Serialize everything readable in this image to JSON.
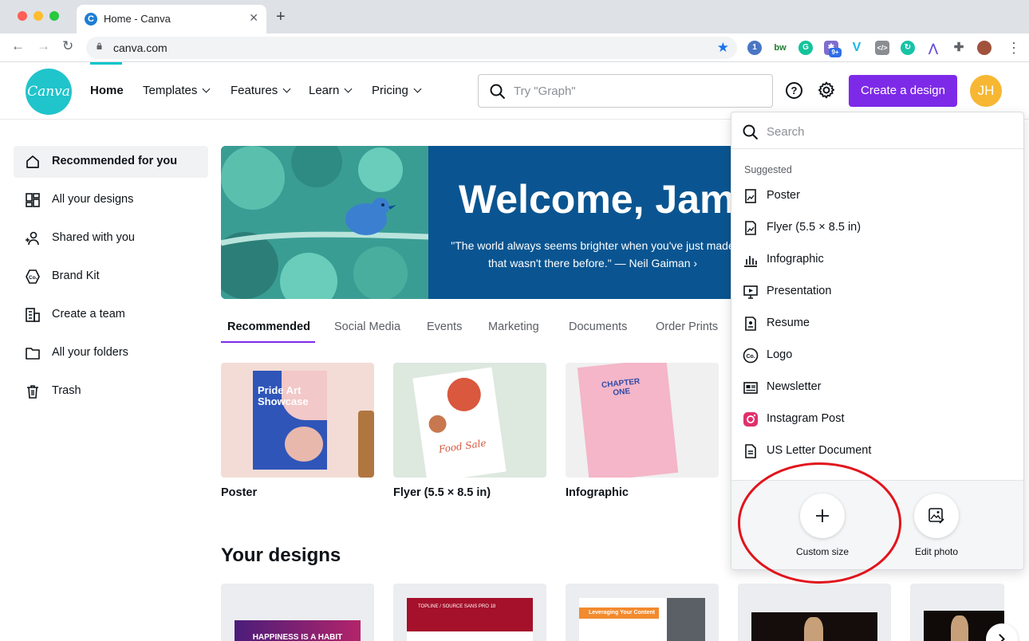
{
  "browser": {
    "tab_title": "Home - Canva",
    "favicon_letter": "C",
    "url": "canva.com",
    "extension_badge": "9+"
  },
  "header": {
    "logo_text": "Canva",
    "nav": [
      {
        "label": "Home"
      },
      {
        "label": "Templates"
      },
      {
        "label": "Features"
      },
      {
        "label": "Learn"
      },
      {
        "label": "Pricing"
      }
    ],
    "search_placeholder": "Try \"Graph\"",
    "help_glyph": "?",
    "create_button": "Create a design",
    "avatar_initials": "JH"
  },
  "sidebar": {
    "items": [
      {
        "label": "Recommended for you",
        "icon": "home-icon"
      },
      {
        "label": "All your designs",
        "icon": "grid-icon"
      },
      {
        "label": "Shared with you",
        "icon": "people-add-icon"
      },
      {
        "label": "Brand Kit",
        "icon": "brand-kit-icon"
      },
      {
        "label": "Create a team",
        "icon": "building-icon"
      },
      {
        "label": "All your folders",
        "icon": "folder-icon"
      },
      {
        "label": "Trash",
        "icon": "trash-icon"
      }
    ]
  },
  "banner": {
    "title": "Welcome, Jame",
    "quote_line1": "\"The world always seems brighter when you've just made",
    "quote_line2": "that wasn't there before.\" — Neil Gaiman ›"
  },
  "categories": {
    "tabs": [
      "Recommended",
      "Social Media",
      "Events",
      "Marketing",
      "Documents",
      "Order Prints"
    ]
  },
  "templates": [
    {
      "label": "Poster",
      "thumb_title": "Pride Art Showcase"
    },
    {
      "label": "Flyer (5.5 × 8.5 in)",
      "thumb_title": "Food Sale"
    },
    {
      "label": "Infographic",
      "thumb_title": "CHAPTER ONE"
    }
  ],
  "your_designs": {
    "title": "Your designs",
    "thumbs": [
      "HAPPINESS IS A HABIT",
      "TOPLINE / SOURCE SANS PRO 18",
      "Leveraging Your Content",
      "",
      ""
    ]
  },
  "dropdown": {
    "search_placeholder": "Search",
    "heading": "Suggested",
    "items": [
      {
        "label": "Poster",
        "icon": "poster-icon"
      },
      {
        "label": "Flyer (5.5 × 8.5 in)",
        "icon": "flyer-icon"
      },
      {
        "label": "Infographic",
        "icon": "bar-chart-icon"
      },
      {
        "label": "Presentation",
        "icon": "presentation-icon"
      },
      {
        "label": "Resume",
        "icon": "resume-icon"
      },
      {
        "label": "Logo",
        "icon": "logo-co-icon"
      },
      {
        "label": "Newsletter",
        "icon": "newsletter-icon"
      },
      {
        "label": "Instagram Post",
        "icon": "instagram-icon"
      },
      {
        "label": "US Letter Document",
        "icon": "document-icon"
      }
    ],
    "custom_size": "Custom size",
    "edit_photo": "Edit photo"
  },
  "colors": {
    "accent": "#7d2ae8",
    "brand_teal": "#20c4cb",
    "banner_blue": "#0a5591",
    "highlight_red": "#e1141c"
  }
}
